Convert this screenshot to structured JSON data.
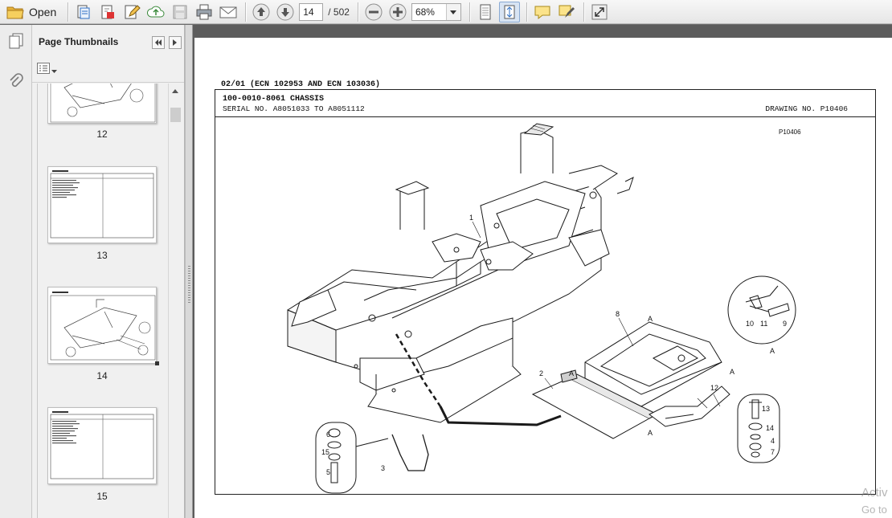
{
  "toolbar": {
    "open_label": "Open",
    "current_page": "14",
    "total_pages": "/ 502",
    "zoom": "68%"
  },
  "panel": {
    "title": "Page Thumbnails",
    "thumbnails": [
      {
        "label": "12"
      },
      {
        "label": "13"
      },
      {
        "label": "14"
      },
      {
        "label": "15"
      }
    ]
  },
  "document": {
    "header_date": "02/01 (ECN 102953 AND ECN 103036)",
    "title": "100-0010-8061 CHASSIS",
    "serial": "SERIAL NO. A8051033 TO A8051112",
    "drawing_no": "DRAWING NO. P10406",
    "drawing_code": "P10406",
    "callouts": [
      "1",
      "2",
      "3",
      "4",
      "5",
      "6",
      "7",
      "8",
      "9",
      "10",
      "11",
      "12",
      "13",
      "14",
      "15",
      "A"
    ]
  },
  "watermark": {
    "line1": "Activ",
    "line2": "Go to"
  },
  "colors": {
    "toolbar_bg": "#ececec",
    "doc_bg": "#5c5c5c",
    "accent_blue": "#2f6fc4",
    "folder_yellow": "#e8b33a"
  }
}
